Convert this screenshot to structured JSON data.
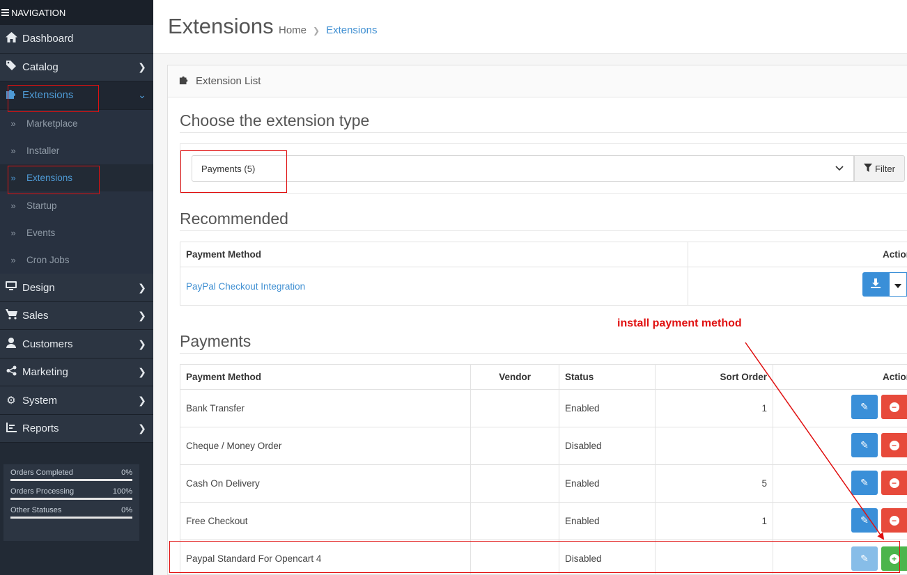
{
  "sidebar": {
    "header": "NAVIGATION",
    "menu": {
      "dashboard": "Dashboard",
      "catalog": "Catalog",
      "extensions": "Extensions",
      "design": "Design",
      "sales": "Sales",
      "customers": "Customers",
      "marketing": "Marketing",
      "system": "System",
      "reports": "Reports"
    },
    "extensions_submenu": [
      "Marketplace",
      "Installer",
      "Extensions",
      "Startup",
      "Events",
      "Cron Jobs"
    ],
    "stats": [
      {
        "label": "Orders Completed",
        "value": "0%"
      },
      {
        "label": "Orders Processing",
        "value": "100%"
      },
      {
        "label": "Other Statuses",
        "value": "0%"
      }
    ]
  },
  "header": {
    "title": "Extensions",
    "breadcrumb": {
      "home": "Home",
      "current": "Extensions"
    }
  },
  "card": {
    "title": "Extension List",
    "choose_heading": "Choose the extension type",
    "type_selected": "Payments (5)",
    "filter_label": "Filter",
    "recommended": {
      "heading": "Recommended",
      "col_method": "Payment Method",
      "col_action": "Action",
      "item": "PayPal Checkout Integration"
    },
    "payments": {
      "heading": "Payments",
      "columns": {
        "method": "Payment Method",
        "vendor": "Vendor",
        "status": "Status",
        "sort_order": "Sort Order",
        "action": "Action"
      },
      "rows": [
        {
          "method": "Bank Transfer",
          "vendor": "",
          "status": "Enabled",
          "sort_order": "1"
        },
        {
          "method": "Cheque / Money Order",
          "vendor": "",
          "status": "Disabled",
          "sort_order": ""
        },
        {
          "method": "Cash On Delivery",
          "vendor": "",
          "status": "Enabled",
          "sort_order": "5"
        },
        {
          "method": "Free Checkout",
          "vendor": "",
          "status": "Enabled",
          "sort_order": "1"
        },
        {
          "method": "Paypal Standard For Opencart 4",
          "vendor": "",
          "status": "Disabled",
          "sort_order": ""
        }
      ]
    }
  },
  "annotation": {
    "text": "install payment method",
    "color": "#e01010"
  },
  "colors": {
    "sidebar_bg": "#222a35",
    "accent_blue": "#3a8fd8",
    "danger_red": "#e74a3b",
    "success_green": "#4cb54c"
  }
}
